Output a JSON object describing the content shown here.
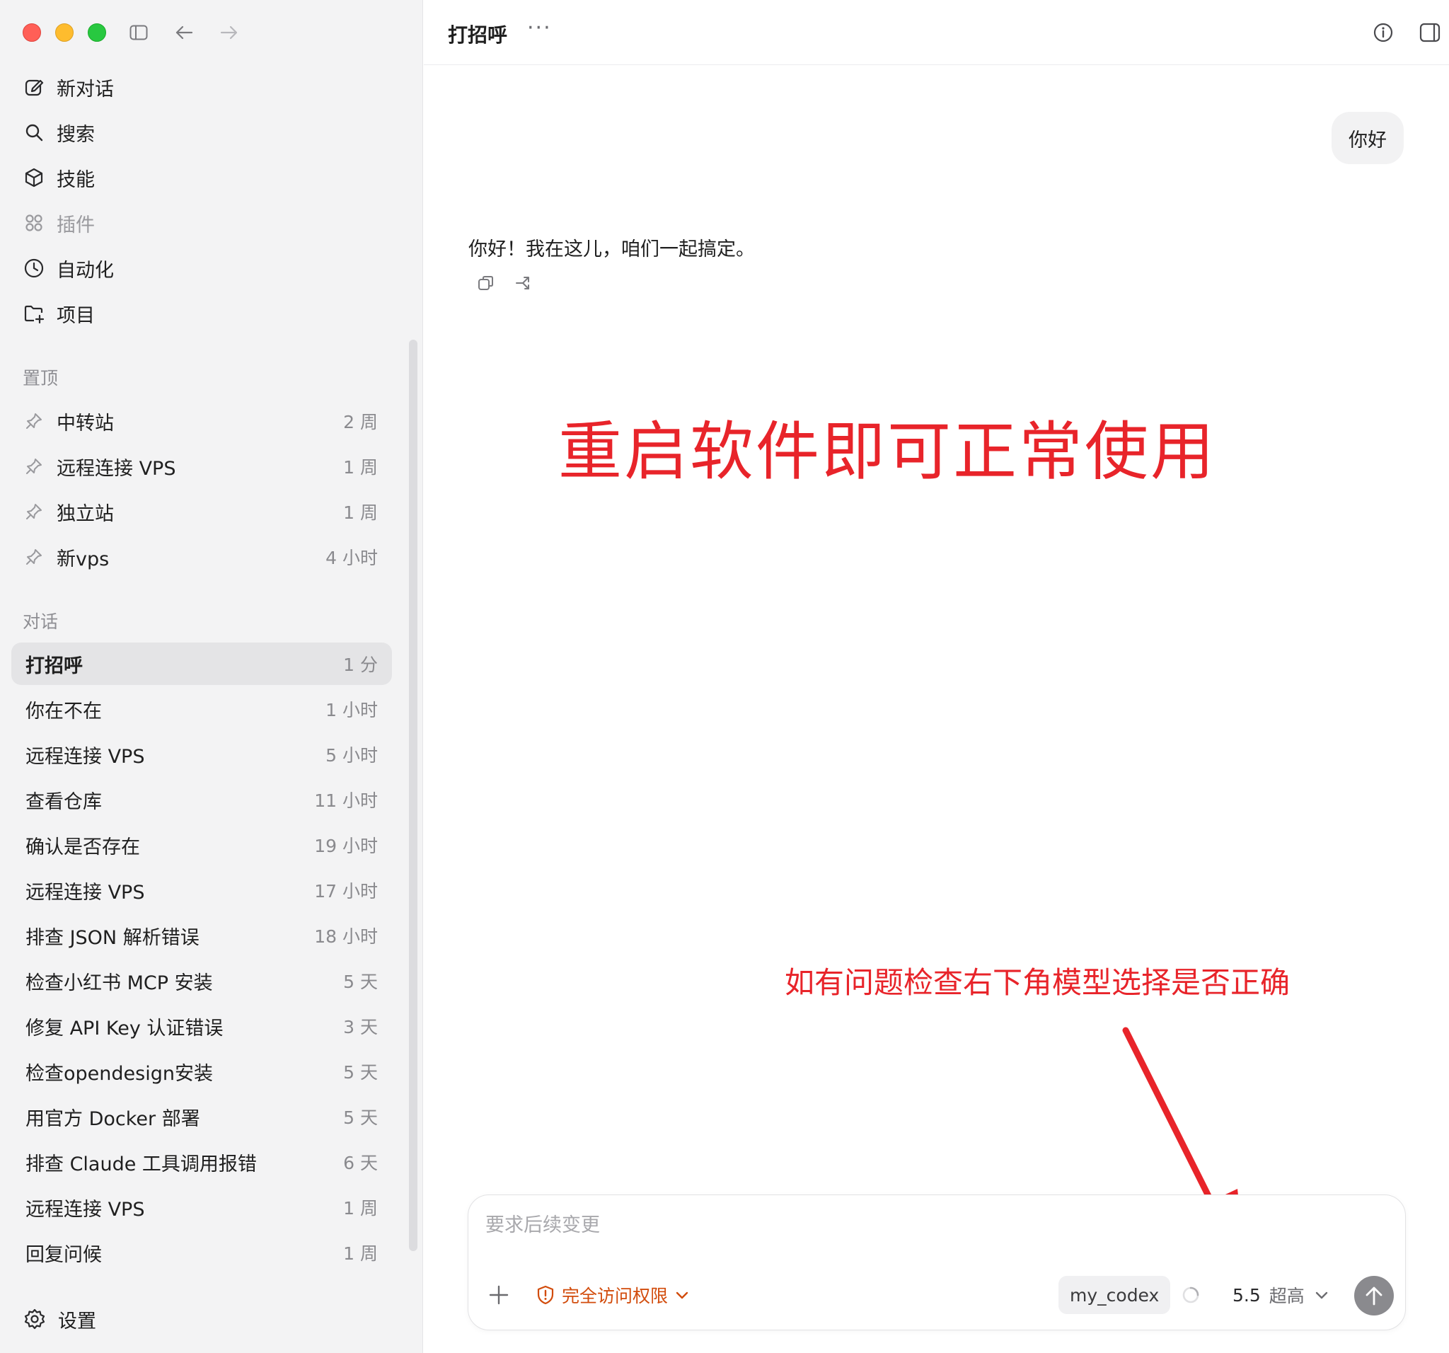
{
  "sidebar": {
    "nav": [
      {
        "label": "新对话",
        "icon": "new-chat-icon"
      },
      {
        "label": "搜索",
        "icon": "search-icon"
      },
      {
        "label": "技能",
        "icon": "skills-cube-icon"
      },
      {
        "label": "插件",
        "icon": "plugins-grid-icon"
      },
      {
        "label": "自动化",
        "icon": "clock-icon"
      },
      {
        "label": "项目",
        "icon": "folder-add-icon"
      }
    ],
    "pinned_label": "置顶",
    "pinned": [
      {
        "title": "中转站",
        "time": "2 周"
      },
      {
        "title": "远程连接 VPS",
        "time": "1 周"
      },
      {
        "title": "独立站",
        "time": "1 周"
      },
      {
        "title": "新vps",
        "time": "4 小时"
      }
    ],
    "conversations_label": "对话",
    "conversations": [
      {
        "title": "打招呼",
        "time": "1 分"
      },
      {
        "title": "你在不在",
        "time": "1 小时"
      },
      {
        "title": "远程连接 VPS",
        "time": "5 小时"
      },
      {
        "title": "查看仓库",
        "time": "11 小时"
      },
      {
        "title": "确认是否存在",
        "time": "19 小时"
      },
      {
        "title": "远程连接 VPS",
        "time": "17 小时"
      },
      {
        "title": "排查 JSON 解析错误",
        "time": "18 小时"
      },
      {
        "title": "检查小红书 MCP 安装",
        "time": "5 天"
      },
      {
        "title": "修复 API Key 认证错误",
        "time": "3 天"
      },
      {
        "title": "检查opendesign安装",
        "time": "5 天"
      },
      {
        "title": "用官方 Docker 部署",
        "time": "5 天"
      },
      {
        "title": "排查 Claude 工具调用报错",
        "time": "6 天"
      },
      {
        "title": "远程连接 VPS",
        "time": "1 周"
      },
      {
        "title": "回复问候",
        "time": "1 周"
      }
    ],
    "settings_label": "设置"
  },
  "header": {
    "title": "打招呼",
    "more": "···"
  },
  "chat": {
    "user_message": "你好",
    "assistant_message": "你好！我在这儿，咱们一起搞定。"
  },
  "annotations": {
    "big": "重启软件即可正常使用",
    "small": "如有问题检查右下角模型选择是否正确",
    "color": "#e8242a"
  },
  "composer": {
    "placeholder": "要求后续变更",
    "access_label": "完全访问权限",
    "profile": "my_codex",
    "model": "5.5",
    "level": "超高"
  },
  "colors": {
    "sidebar_bg": "#f3f3f4",
    "active_row": "#e4e4e6",
    "access_orange": "#d24c0c",
    "send_button": "#8a8a8e"
  }
}
